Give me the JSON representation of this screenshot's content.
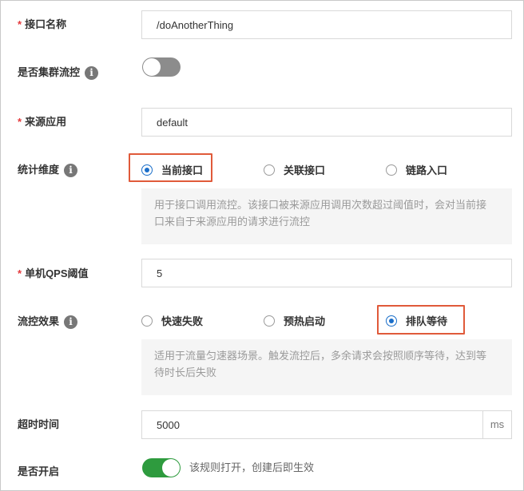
{
  "form": {
    "api_name": {
      "label": "接口名称",
      "required": "*",
      "value": "/doAnotherThing"
    },
    "cluster": {
      "label": "是否集群流控",
      "info": "i",
      "on": false
    },
    "source_app": {
      "label": "来源应用",
      "required": "*",
      "value": "default"
    },
    "stat_dimension": {
      "label": "统计维度",
      "info": "i",
      "options": [
        "当前接口",
        "关联接口",
        "链路入口"
      ],
      "selected": "当前接口",
      "description": [
        "用于接口调用流控。该接口被来源应用调用次数超过阈值时，会对当前接",
        "口来自于来源应用的请求进行流控"
      ]
    },
    "qps": {
      "label": "单机QPS阈值",
      "required": "*",
      "value": "5"
    },
    "effect": {
      "label": "流控效果",
      "info": "i",
      "options": [
        "快速失败",
        "预热启动",
        "排队等待"
      ],
      "selected": "排队等待",
      "description": [
        "适用于流量匀速器场景。触发流控后，多余请求会按照顺序等待，达到等",
        "待时长后失败"
      ]
    },
    "timeout": {
      "label": "超时时间",
      "value": "5000",
      "unit": "ms"
    },
    "enabled": {
      "label": "是否开启",
      "on": true,
      "hint": "该规则打开，创建后即生效"
    }
  },
  "colors": {
    "toggle_on": "#2e9b3e",
    "toggle_off": "#8c8c8c",
    "radio_checked": "#1a6ec9",
    "highlight": "#e05a3a",
    "required": "#e4393c"
  }
}
